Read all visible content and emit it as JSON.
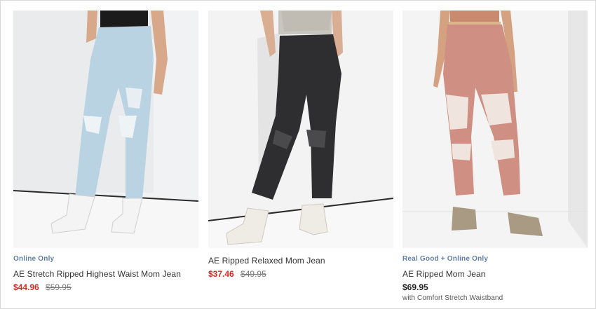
{
  "products": [
    {
      "badge": "Online Only",
      "name": "AE Stretch Ripped Highest Waist Mom Jean",
      "sale_price": "$44.96",
      "original_price": "$59.95",
      "image": "light-blue-ripped-mom-jean-photo",
      "colors": {
        "jean": "#b9d3e3",
        "shoe": "#f4f4f4",
        "top": "#1b1b1b",
        "skin": "#d8a88a"
      }
    },
    {
      "badge": "",
      "name": "AE Ripped Relaxed Mom Jean",
      "sale_price": "$37.46",
      "original_price": "$49.95",
      "image": "black-ripped-relaxed-mom-jean-photo",
      "colors": {
        "jean": "#2e2e30",
        "shoe": "#efece6",
        "top": "#c9c6c0",
        "skin": "#d9ae92"
      }
    },
    {
      "badge": "Real Good + Online Only",
      "name": "AE Ripped Mom Jean",
      "price": "$69.95",
      "note": "with Comfort Stretch Waistband",
      "image": "pink-ripped-mom-jean-photo",
      "colors": {
        "jean": "#cf8f83",
        "shoe": "#a99a84",
        "top": "#c98a70",
        "skin": "#d4a181"
      }
    }
  ],
  "theme": {
    "badge_color": "#5f7fa8",
    "sale_color": "#d42b24",
    "text_color": "#333333"
  }
}
